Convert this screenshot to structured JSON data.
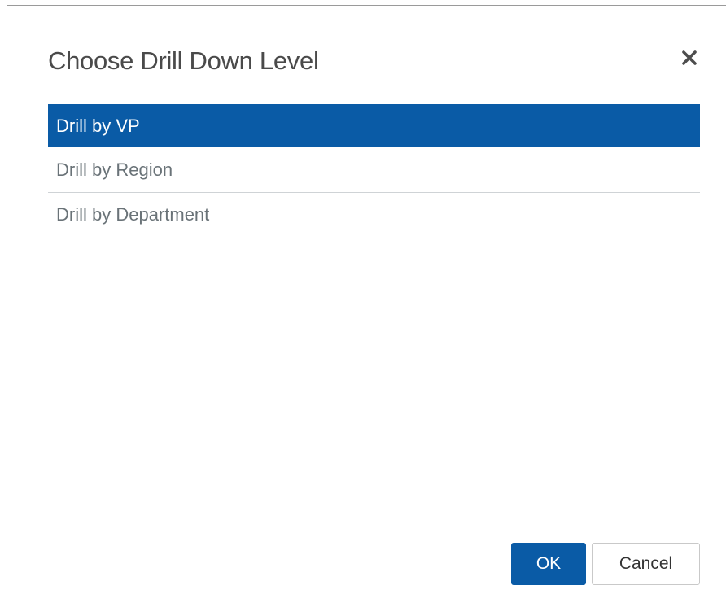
{
  "dialog": {
    "title": "Choose Drill Down Level",
    "close_icon": "close-icon"
  },
  "levels": {
    "items": [
      {
        "label": "Drill by VP",
        "selected": true
      },
      {
        "label": "Drill by Region",
        "selected": false
      },
      {
        "label": "Drill by Department",
        "selected": false
      }
    ]
  },
  "footer": {
    "ok_label": "OK",
    "cancel_label": "Cancel"
  },
  "colors": {
    "accent": "#0a5ba6",
    "list_text": "#6a7378",
    "title_text": "#4a4a4a"
  }
}
